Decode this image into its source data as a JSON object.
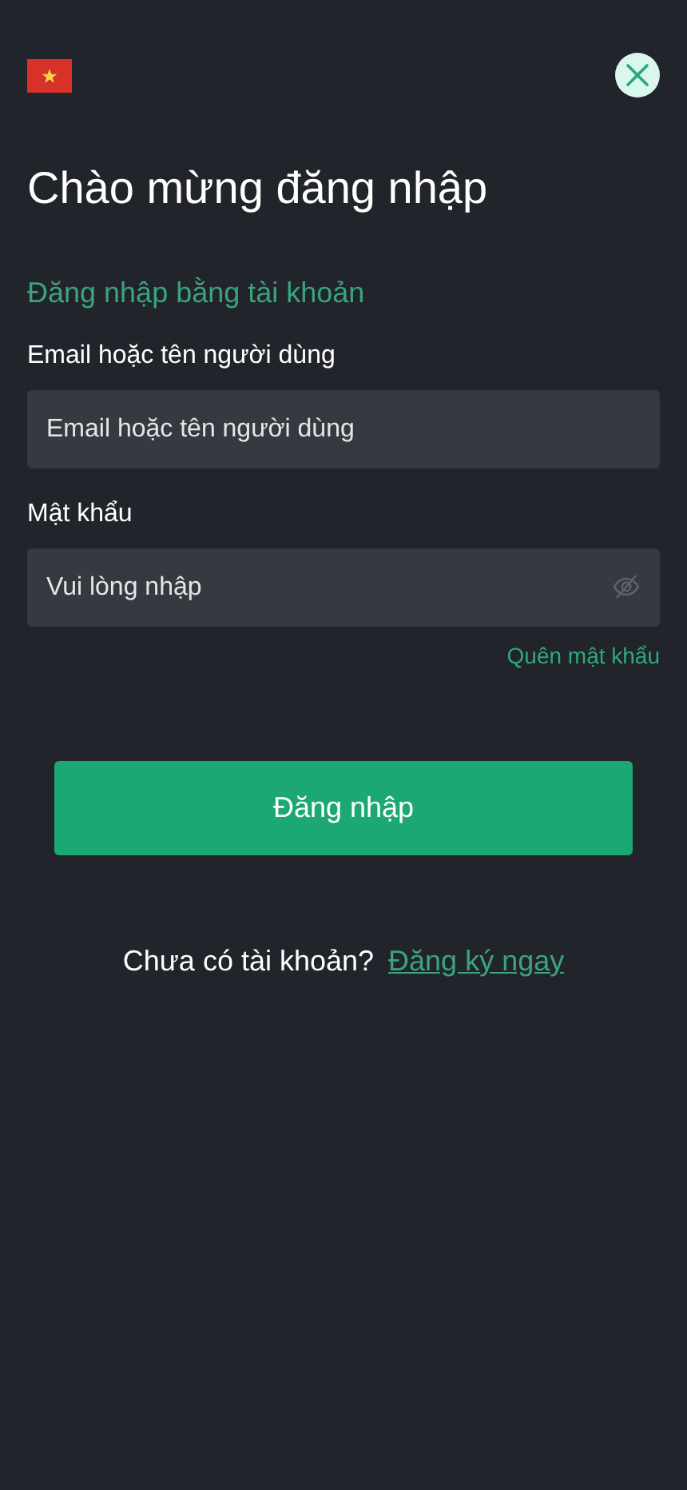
{
  "title": "Chào mừng đăng nhập",
  "login_method": "Đăng nhập bằng tài khoản",
  "fields": [
    {
      "label": "Email hoặc tên người dùng",
      "placeholder": "Email hoặc tên người dùng",
      "kind": "text"
    },
    {
      "label": "Mật khẩu",
      "placeholder": "Vui lòng nhập",
      "kind": "password",
      "password_visible": false
    }
  ],
  "forgot_password": "Quên mật khẩu",
  "submit_button": "Đăng nhập",
  "footer": {
    "text": "Chưa có tài khoản?",
    "link": "Đăng ký ngay"
  }
}
